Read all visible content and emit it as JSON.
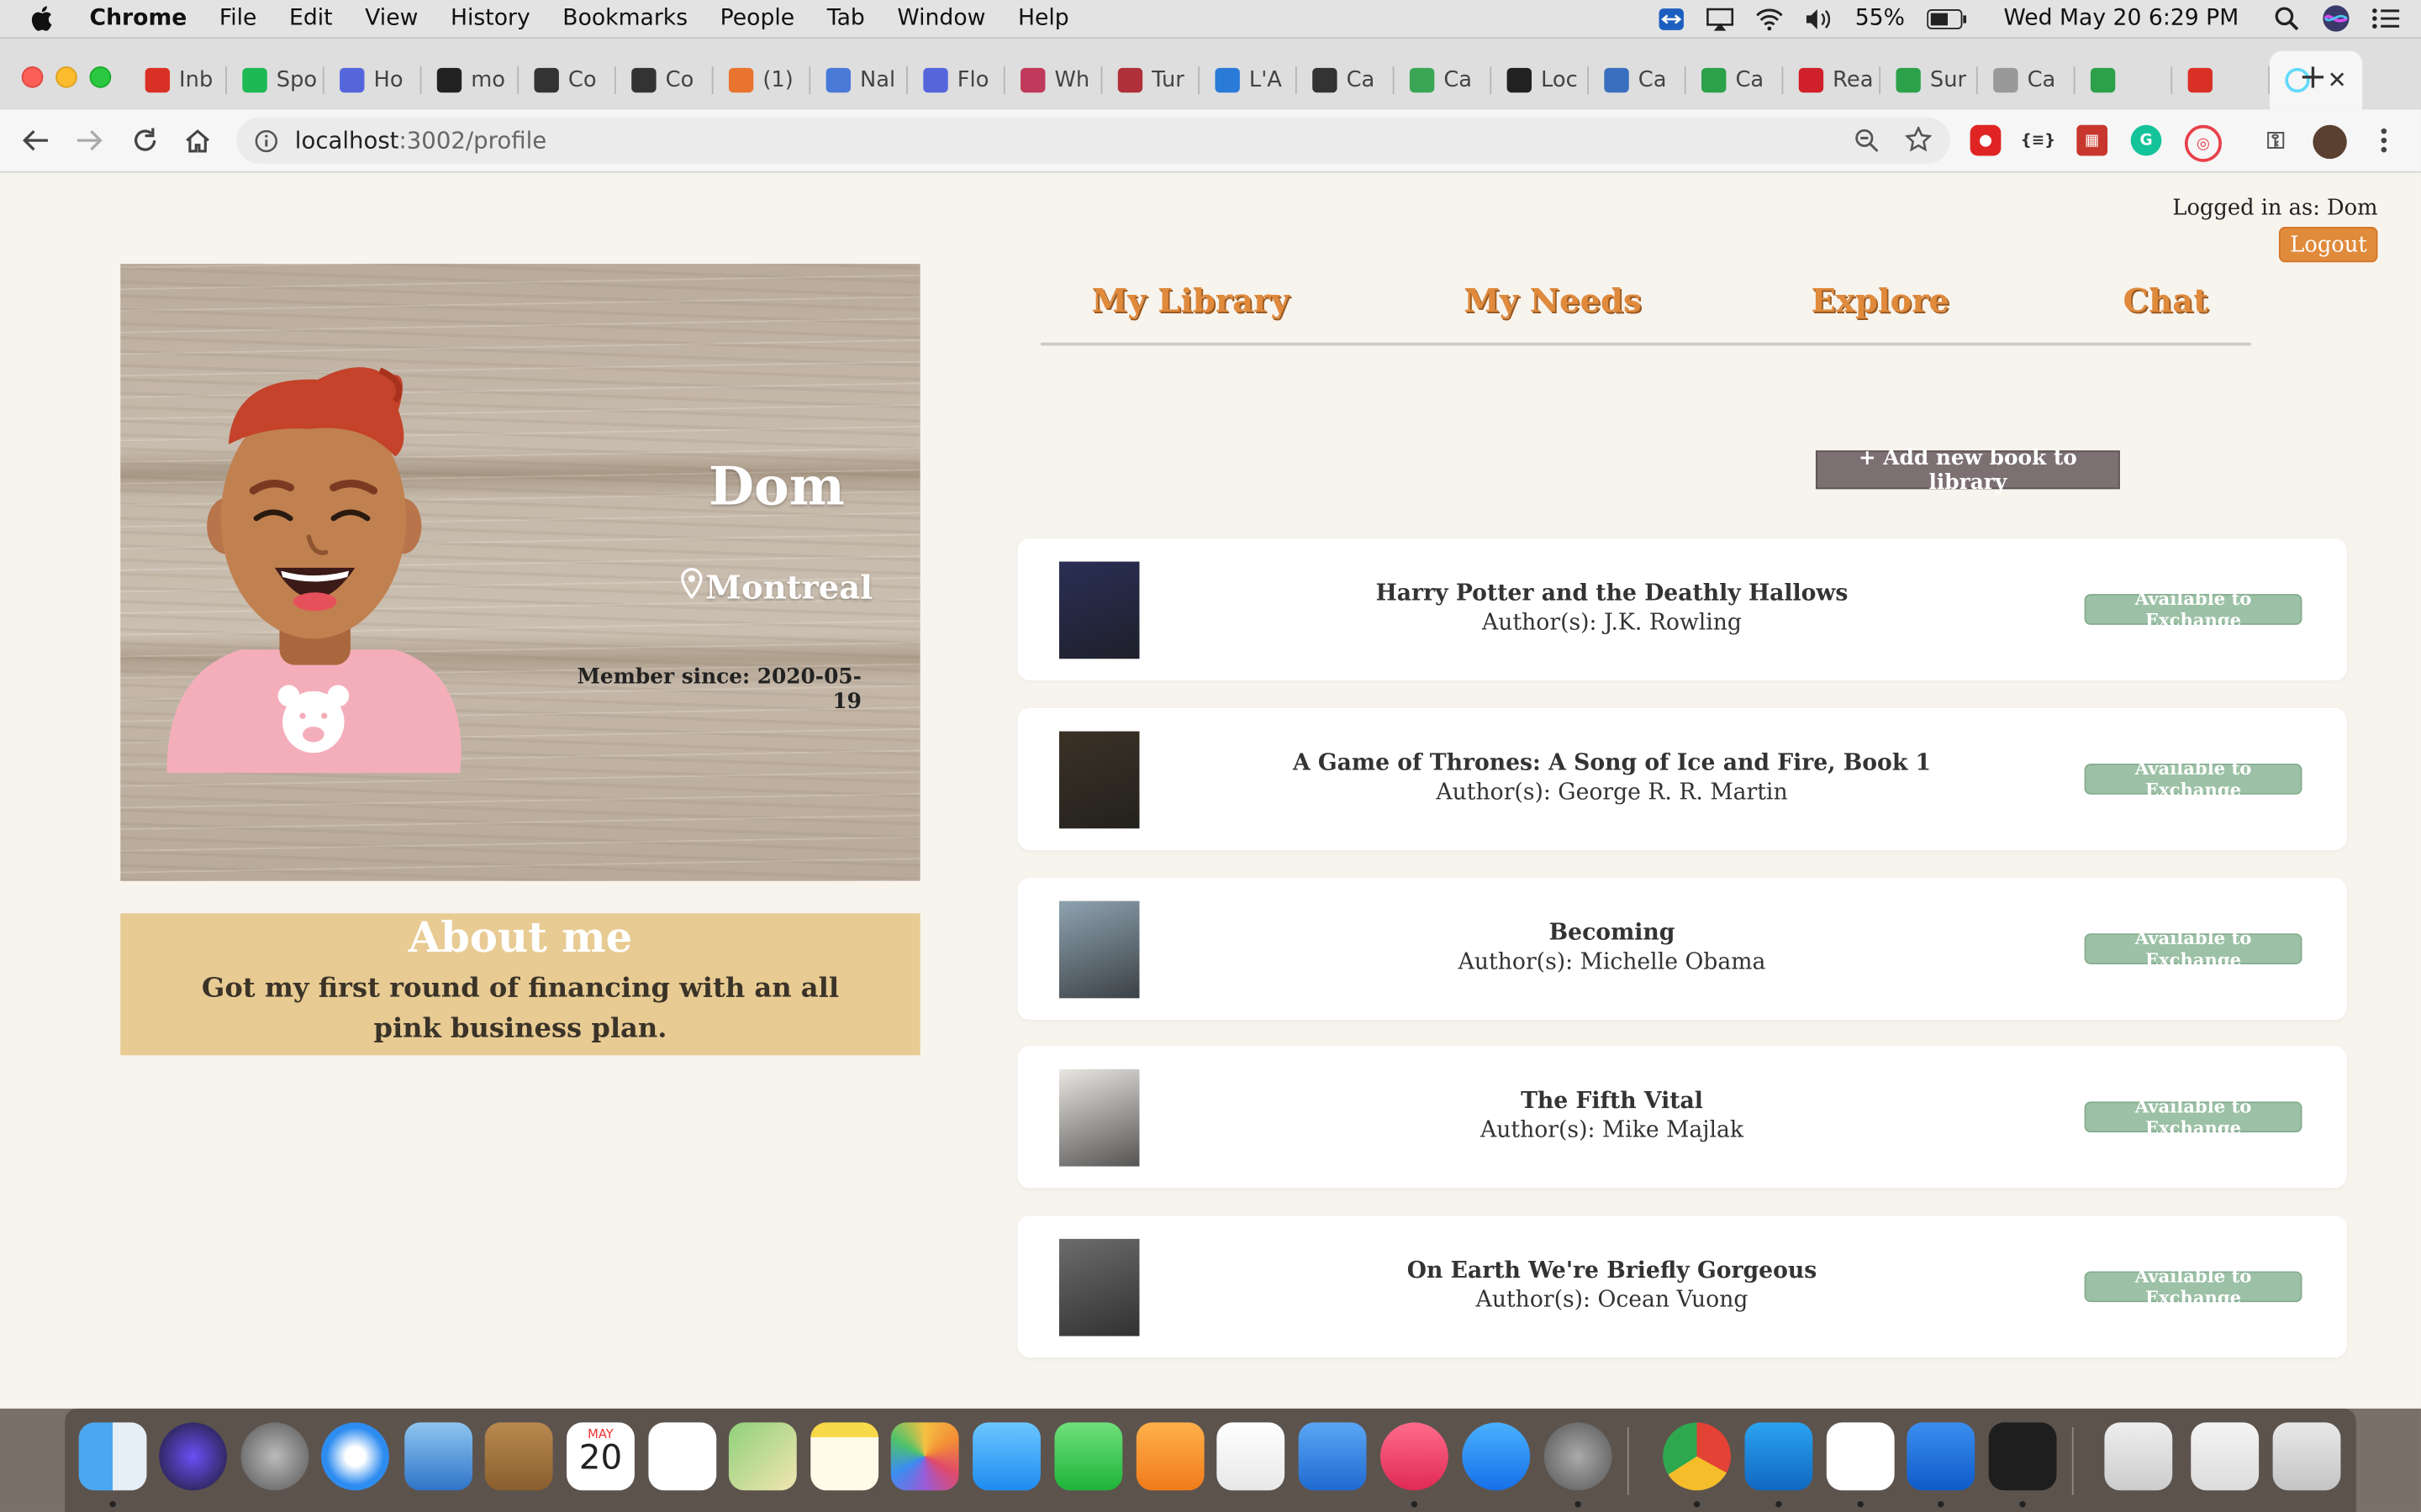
{
  "menubar": {
    "app": "Chrome",
    "items": [
      "File",
      "Edit",
      "View",
      "History",
      "Bookmarks",
      "People",
      "Tab",
      "Window",
      "Help"
    ],
    "battery": "55%",
    "datetime": "Wed May 20  6:29 PM"
  },
  "tabs": [
    {
      "label": "Inb",
      "color": "#d93025"
    },
    {
      "label": "Spo",
      "color": "#1db954"
    },
    {
      "label": "Ho",
      "color": "#5566dd"
    },
    {
      "label": "mo",
      "color": "#222222"
    },
    {
      "label": "Co",
      "color": "#333333"
    },
    {
      "label": "Co",
      "color": "#333333"
    },
    {
      "label": "(1)",
      "color": "#e8742f"
    },
    {
      "label": "Nal",
      "color": "#4a7ad8"
    },
    {
      "label": "Flo",
      "color": "#5566dd"
    },
    {
      "label": "Wh",
      "color": "#c03a5c"
    },
    {
      "label": "Tur",
      "color": "#b0303a"
    },
    {
      "label": "L'A",
      "color": "#2a7ad8"
    },
    {
      "label": "Ca",
      "color": "#333333"
    },
    {
      "label": "Ca",
      "color": "#3aa655"
    },
    {
      "label": "Loc",
      "color": "#222222"
    },
    {
      "label": "Ca",
      "color": "#3a6fc0"
    },
    {
      "label": "Ca",
      "color": "#2ca14a"
    },
    {
      "label": "Rea",
      "color": "#d0202a"
    },
    {
      "label": "Sur",
      "color": "#2ca14a"
    },
    {
      "label": "Ca",
      "color": "#999999"
    },
    {
      "label": "",
      "color": "#2ca14a"
    },
    {
      "label": "",
      "color": "#d93025"
    }
  ],
  "active_tab": {
    "label": "",
    "color": "#61dafb"
  },
  "toolbar": {
    "url_host": "localhost",
    "url_rest": ":3002/profile"
  },
  "header": {
    "logged_in": "Logged in as: Dom",
    "logout": "Logout"
  },
  "profile": {
    "name": "Dom",
    "location": "Montreal",
    "member_since": "Member since: 2020-05-19",
    "about_title": "About me",
    "about_text": "Got my first round of financing with an all pink business plan."
  },
  "nav": [
    "My Library",
    "My Needs",
    "Explore",
    "Chat"
  ],
  "add_book_label": "+ Add new book to library",
  "books": [
    {
      "title": "Harry Potter and the Deathly Hallows",
      "author": "Author(s): J.K. Rowling",
      "status": "Available to Exchange",
      "cover": "#2a2f55"
    },
    {
      "title": "A Game of Thrones: A Song of Ice and Fire, Book 1",
      "author": "Author(s): George R. R. Martin",
      "status": "Available to Exchange",
      "cover": "#3b3226"
    },
    {
      "title": "Becoming",
      "author": "Author(s): Michelle Obama",
      "status": "Available to Exchange",
      "cover": "#8fa3b1"
    },
    {
      "title": "The Fifth Vital",
      "author": "Author(s): Mike Majlak",
      "status": "Available to Exchange",
      "cover": "#e9e6e2"
    },
    {
      "title": "On Earth We're Briefly Gorgeous",
      "author": "Author(s): Ocean Vuong",
      "status": "Available to Exchange",
      "cover": "#6c6c6c"
    }
  ],
  "dock": {
    "calendar_month": "MAY",
    "calendar_day": "20"
  }
}
